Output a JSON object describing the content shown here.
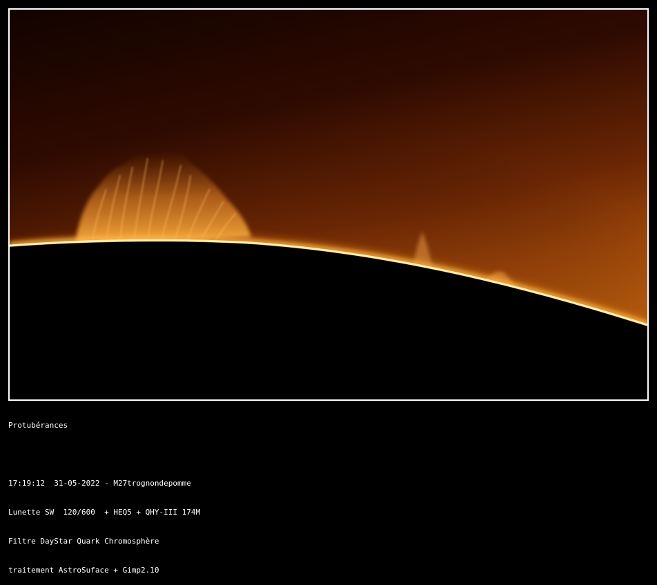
{
  "image": {
    "subject": "solar-prominences-photo",
    "colors": {
      "sky_dark": "#140400",
      "sky_mid": "#5a1e02",
      "sky_bright": "#b5520c",
      "limb": "#ffd870",
      "disk": "#000000",
      "frame": "#ffffff"
    }
  },
  "caption": {
    "title": "Protubérances",
    "blank": "",
    "line1": "17:19:12  31-05-2022 - M27trognondepomme",
    "line2": "Lunette SW  120/600  + HEQ5 + QHY-III 174M",
    "line3": "Filtre DayStar Quark Chromosphère",
    "line4": "traitement AstroSuface + Gimp2.10"
  }
}
